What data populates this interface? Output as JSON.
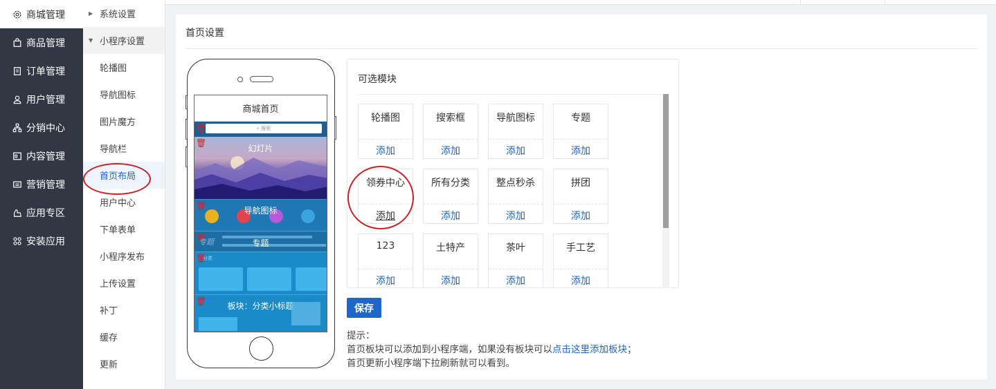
{
  "sidebar": {
    "items": [
      {
        "label": "商城管理",
        "icon": "gear-icon"
      },
      {
        "label": "商品管理",
        "icon": "bag-icon"
      },
      {
        "label": "订单管理",
        "icon": "document-icon"
      },
      {
        "label": "用户管理",
        "icon": "user-icon"
      },
      {
        "label": "分销中心",
        "icon": "network-icon"
      },
      {
        "label": "内容管理",
        "icon": "content-icon"
      },
      {
        "label": "营销管理",
        "icon": "ticket-icon"
      },
      {
        "label": "应用专区",
        "icon": "app-icon"
      },
      {
        "label": "安装应用",
        "icon": "grid-icon"
      }
    ]
  },
  "submenu": {
    "items": [
      {
        "label": "系统设置",
        "type": "parent-collapsed"
      },
      {
        "label": "小程序设置",
        "type": "parent-open"
      },
      {
        "label": "轮播图"
      },
      {
        "label": "导航图标"
      },
      {
        "label": "图片魔方"
      },
      {
        "label": "导航栏"
      },
      {
        "label": "首页布局",
        "selected": true
      },
      {
        "label": "用户中心"
      },
      {
        "label": "下单表单"
      },
      {
        "label": "小程序发布"
      },
      {
        "label": "上传设置"
      },
      {
        "label": "补丁"
      },
      {
        "label": "缓存"
      },
      {
        "label": "更新"
      }
    ]
  },
  "page": {
    "title": "首页设置"
  },
  "phone": {
    "screen_title": "商城首页",
    "search_placeholder": "搜索",
    "blocks": [
      {
        "label": "幻灯片"
      },
      {
        "label": "导航图标"
      },
      {
        "label": "专题",
        "stamp": "专题"
      },
      {
        "label": "",
        "stamp": "分类"
      },
      {
        "label": "板块：分类小标题"
      }
    ]
  },
  "modules": {
    "title": "可选模块",
    "add_label": "添加",
    "items": [
      {
        "name": "轮播图"
      },
      {
        "name": "搜索框"
      },
      {
        "name": "导航图标"
      },
      {
        "name": "专题"
      },
      {
        "name": "领券中心"
      },
      {
        "name": "所有分类"
      },
      {
        "name": "整点秒杀"
      },
      {
        "name": "拼团"
      },
      {
        "name": "123"
      },
      {
        "name": "土特产"
      },
      {
        "name": "茶叶"
      },
      {
        "name": "手工艺"
      }
    ]
  },
  "save_label": "保存",
  "tips": {
    "title": "提示：",
    "line1_prefix": "首页板块可以添加到小程序端，如果没有板块可以",
    "line1_link": "点击这里添加板块",
    "line1_suffix": "；",
    "line2": "首页更新小程序端下拉刷新就可以看到。"
  },
  "colors": {
    "accent": "#1e66c9",
    "sidebar_bg": "#333744",
    "highlight_ring": "#cc1f24",
    "trash": "#d3242a"
  }
}
